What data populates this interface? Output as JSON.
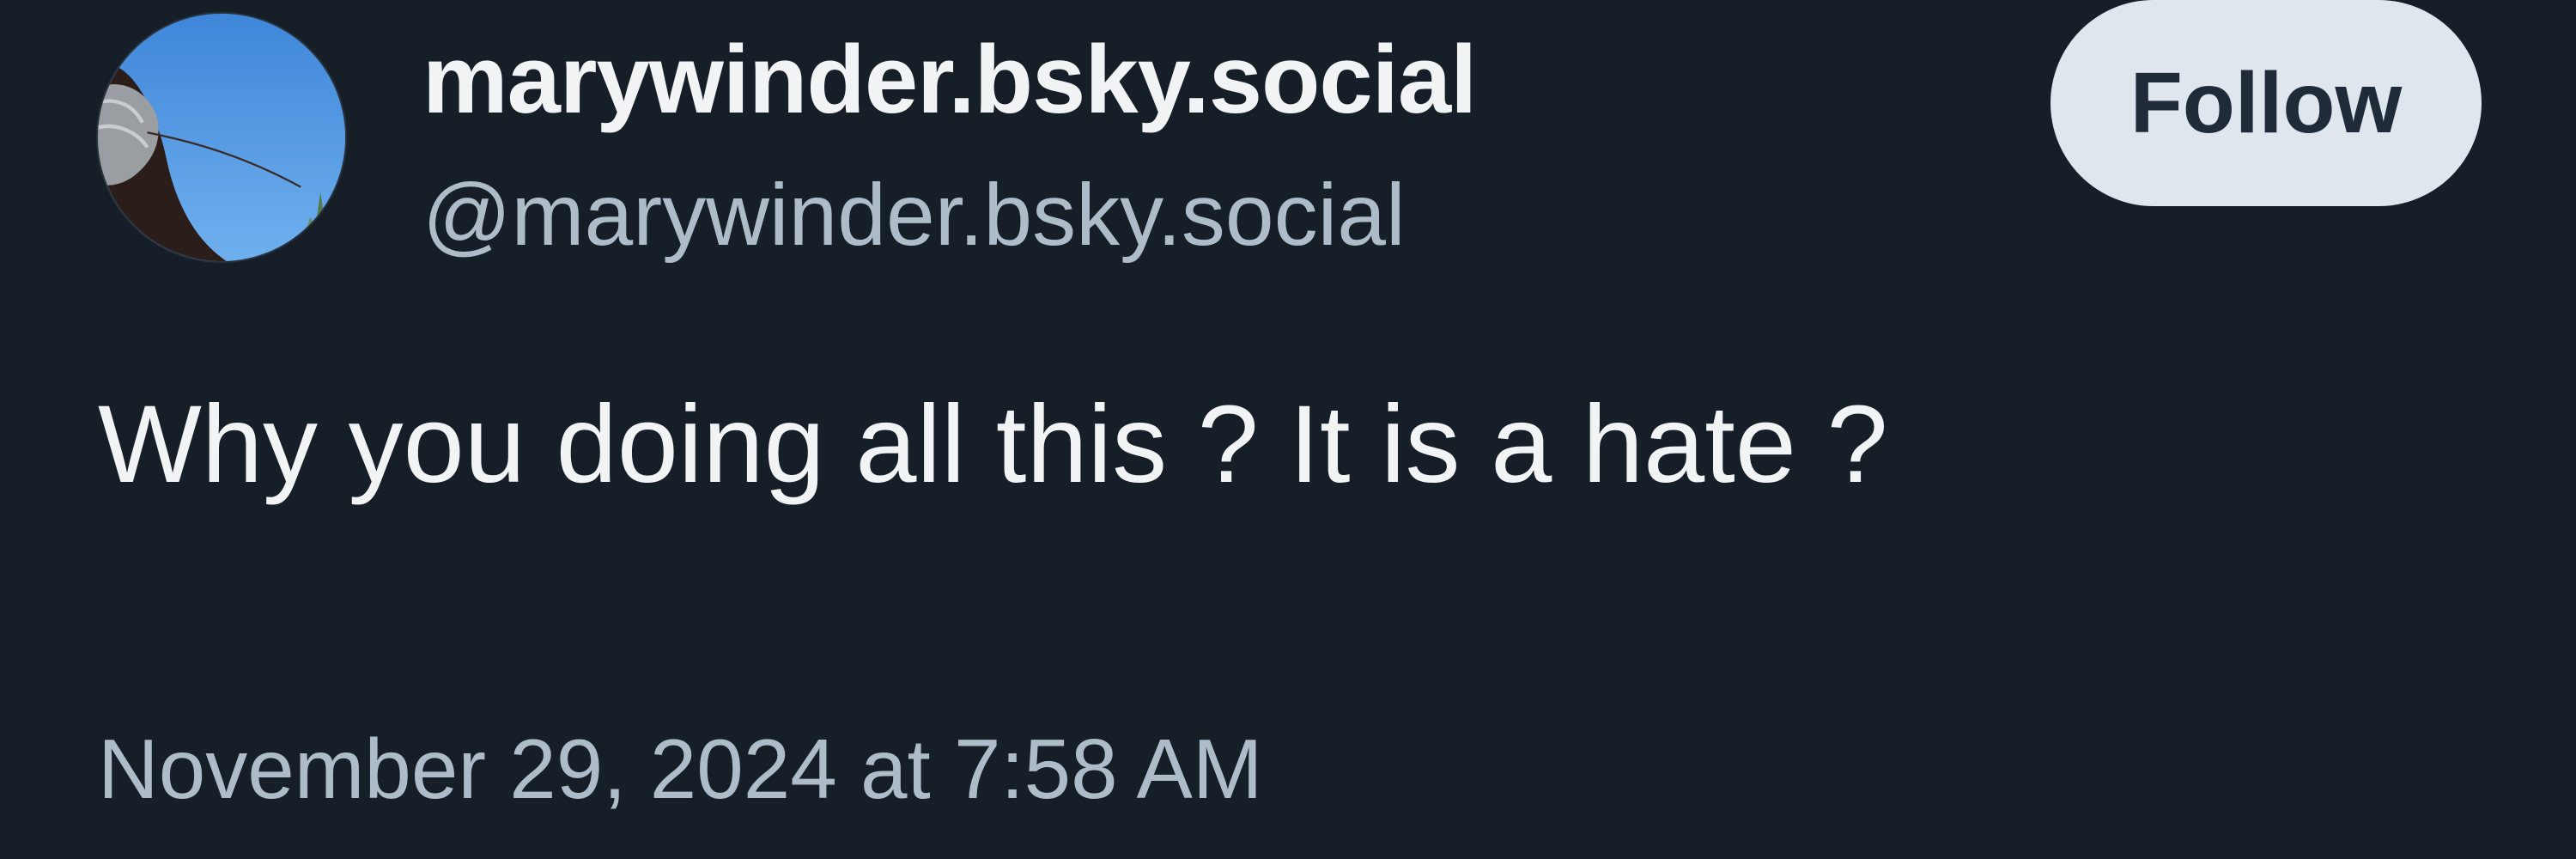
{
  "author": {
    "display_name": "marywinder.bsky.social",
    "handle": "@marywinder.bsky.social"
  },
  "follow_button": {
    "label": "Follow"
  },
  "post": {
    "text": "Why you doing all this ? It is a hate ?",
    "timestamp": "November 29, 2024 at 7:58 AM"
  },
  "colors": {
    "background": "#161e27",
    "primary_text": "#f1f3f5",
    "secondary_text": "#aebbc9",
    "button_bg": "#dfe6ee",
    "button_text": "#1f2b38"
  }
}
